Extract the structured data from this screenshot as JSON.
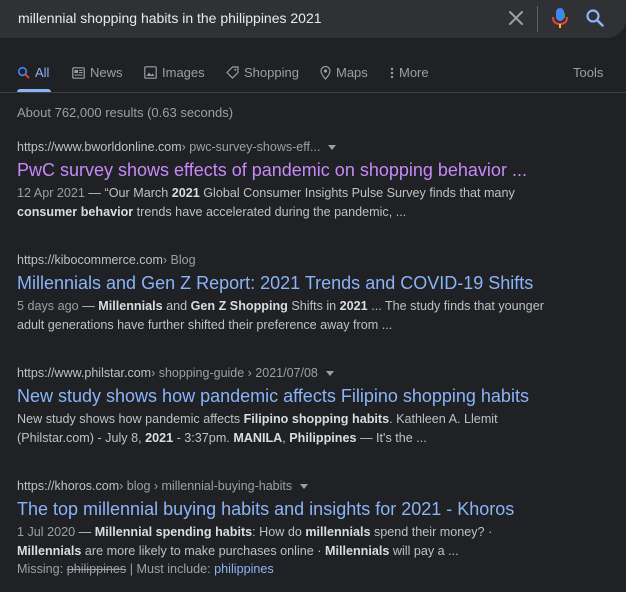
{
  "search": {
    "query": "millennial shopping habits in the philippines 2021",
    "clear_icon": "close-icon",
    "mic_icon": "microphone-icon",
    "search_icon": "search-icon",
    "accent": "#8ab4f8"
  },
  "tabs": [
    {
      "label": "All",
      "icon": "search-icon",
      "active": true
    },
    {
      "label": "News",
      "icon": "news-icon"
    },
    {
      "label": "Images",
      "icon": "image-icon"
    },
    {
      "label": "Shopping",
      "icon": "tag-icon"
    },
    {
      "label": "Maps",
      "icon": "map-pin-icon"
    },
    {
      "label": "More",
      "icon": "kebab-icon"
    }
  ],
  "tools_label": "Tools",
  "result_stats": "About 762,000 results (0.63 seconds)",
  "results": [
    {
      "site": "https://www.bworldonline.com",
      "path": " › pwc-survey-shows-eff...",
      "title": "PwC survey shows effects of pandemic on shopping behavior ...",
      "date": "12 Apr 2021",
      "snippet_line1": " — “Our March ",
      "snippet_b1": "2021",
      "snippet_line1b": " Global Consumer Insights Pulse Survey finds that many",
      "snippet_b2": "consumer behavior",
      "snippet_line2": " trends have accelerated during the pandemic, ..."
    },
    {
      "site": "https://kibocommerce.com",
      "path": " › Blog",
      "title": "Millennials and Gen Z Report: 2021 Trends and COVID-19 Shifts",
      "date": "5 days ago",
      "s1": " — ",
      "b1": "Millennials",
      "s2": " and ",
      "b2": "Gen Z Shopping",
      "s3": " Shifts in ",
      "b3": "2021",
      "s4": " ... The study finds that younger",
      "line2": "adult generations have further shifted their preference away from ..."
    },
    {
      "site": "https://www.philstar.com",
      "path": " › shopping-guide › 2021/07/08",
      "title": "New study shows how pandemic affects Filipino shopping habits",
      "s1": "New study shows how pandemic affects ",
      "b1": "Filipino shopping habits",
      "s2": ". Kathleen A. Llemit",
      "s3": "(Philstar.com) - July 8, ",
      "b2": "2021",
      "s4": " - 3:37pm. ",
      "b3": "MANILA",
      "s5": ", ",
      "b4": "Philippines",
      "s6": " — It's the ..."
    },
    {
      "site": "https://khoros.com",
      "path": " › blog › millennial-buying-habits",
      "title": "The top millennial buying habits and insights for 2021 - Khoros",
      "date": "1 Jul 2020",
      "s1": " — ",
      "b1": "Millennial spending habits",
      "s2": ": How do ",
      "b2": "millennials",
      "s3": " spend their money? ·",
      "b3": "Millennials",
      "s4": " are more likely to make purchases online · ",
      "b4": "Millennials",
      "s5": " will pay a ...",
      "missing_label": "Missing: ",
      "missing_term": "philippines",
      "must_label": " | Must include: ",
      "must_term": "philippines"
    }
  ]
}
